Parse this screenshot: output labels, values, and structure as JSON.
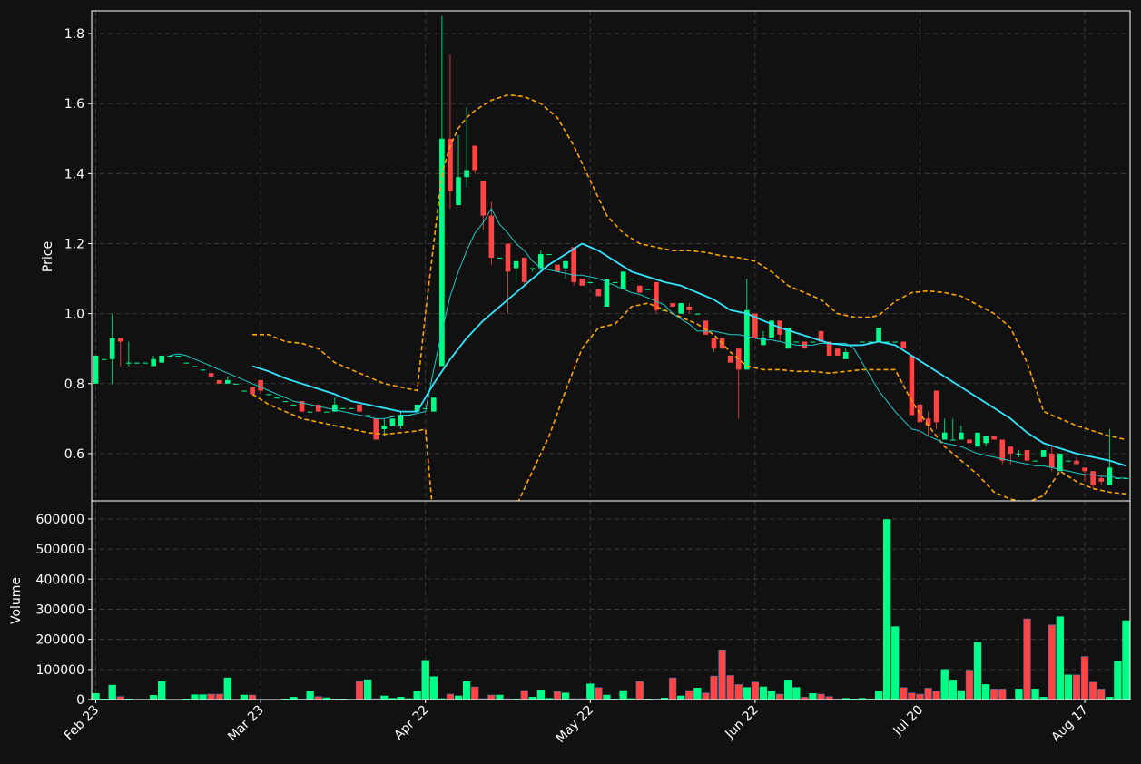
{
  "chart_data": {
    "type": "candlestick",
    "colors": {
      "background": "#111111",
      "up": "#00ff88",
      "down": "#ff4444",
      "grid": "#3a3a3a",
      "axis": "#ffffff",
      "sma_fast": "#1ec8c8",
      "sma_slow": "#33e6ff",
      "bollinger": "#ffa500"
    },
    "price_panel": {
      "ylabel": "Price",
      "ylim": [
        0.465,
        1.865
      ],
      "yticks": [
        0.6,
        0.8,
        1.0,
        1.2,
        1.4,
        1.6,
        1.8
      ],
      "ytick_labels": [
        "0.6",
        "0.8",
        "1.0",
        "1.2",
        "1.4",
        "1.6",
        "1.8"
      ]
    },
    "volume_panel": {
      "ylabel": "Volume",
      "ylim": [
        0,
        660000
      ],
      "yticks": [
        0,
        100000,
        200000,
        300000,
        400000,
        500000,
        600000
      ],
      "ytick_labels": [
        "0",
        "100000",
        "200000",
        "300000",
        "400000",
        "500000",
        "600000"
      ]
    },
    "xlim": [
      -0.5,
      125.5
    ],
    "xticks": [
      0,
      20,
      40,
      60,
      80,
      100,
      120
    ],
    "xtick_labels": [
      "Feb 23",
      "Mar 23",
      "Apr 22",
      "May 22",
      "Jun 22",
      "Jul 20",
      "Aug 17"
    ],
    "candles": [
      [
        0.8,
        0.88,
        0.8,
        0.88
      ],
      [
        0.87,
        0.87,
        0.87,
        0.87
      ],
      [
        0.87,
        1.0,
        0.8,
        0.93
      ],
      [
        0.93,
        0.93,
        0.85,
        0.92
      ],
      [
        0.86,
        0.92,
        0.85,
        0.86
      ],
      [
        0.86,
        0.86,
        0.86,
        0.86
      ],
      [
        0.86,
        0.86,
        0.86,
        0.86
      ],
      [
        0.85,
        0.88,
        0.85,
        0.87
      ],
      [
        0.86,
        0.88,
        0.86,
        0.88
      ],
      [
        0.88,
        0.88,
        0.88,
        0.88
      ],
      [
        0.88,
        0.88,
        0.88,
        0.88
      ],
      [
        0.86,
        0.86,
        0.86,
        0.86
      ],
      [
        0.85,
        0.85,
        0.85,
        0.85
      ],
      [
        0.84,
        0.84,
        0.84,
        0.84
      ],
      [
        0.83,
        0.83,
        0.82,
        0.82
      ],
      [
        0.81,
        0.81,
        0.8,
        0.8
      ],
      [
        0.8,
        0.82,
        0.8,
        0.81
      ],
      [
        0.8,
        0.8,
        0.8,
        0.8
      ],
      [
        0.78,
        0.78,
        0.78,
        0.78
      ],
      [
        0.79,
        0.79,
        0.77,
        0.77
      ],
      [
        0.81,
        0.81,
        0.77,
        0.78
      ],
      [
        0.77,
        0.77,
        0.77,
        0.77
      ],
      [
        0.76,
        0.76,
        0.76,
        0.76
      ],
      [
        0.75,
        0.75,
        0.75,
        0.75
      ],
      [
        0.74,
        0.74,
        0.74,
        0.74
      ],
      [
        0.75,
        0.75,
        0.72,
        0.72
      ],
      [
        0.72,
        0.72,
        0.72,
        0.72
      ],
      [
        0.74,
        0.74,
        0.72,
        0.72
      ],
      [
        0.72,
        0.72,
        0.72,
        0.72
      ],
      [
        0.72,
        0.76,
        0.72,
        0.74
      ],
      [
        0.73,
        0.73,
        0.73,
        0.73
      ],
      [
        0.73,
        0.73,
        0.73,
        0.73
      ],
      [
        0.74,
        0.74,
        0.72,
        0.72
      ],
      [
        0.71,
        0.71,
        0.71,
        0.71
      ],
      [
        0.7,
        0.7,
        0.64,
        0.64
      ],
      [
        0.67,
        0.7,
        0.65,
        0.68
      ],
      [
        0.68,
        0.7,
        0.68,
        0.7
      ],
      [
        0.68,
        0.72,
        0.67,
        0.71
      ],
      [
        0.71,
        0.71,
        0.71,
        0.71
      ],
      [
        0.72,
        0.74,
        0.72,
        0.74
      ],
      [
        0.73,
        0.73,
        0.73,
        0.73
      ],
      [
        0.72,
        0.76,
        0.72,
        0.76
      ],
      [
        0.85,
        1.85,
        0.85,
        1.5
      ],
      [
        1.5,
        1.74,
        1.3,
        1.35
      ],
      [
        1.31,
        1.51,
        1.31,
        1.39
      ],
      [
        1.39,
        1.59,
        1.36,
        1.41
      ],
      [
        1.48,
        1.48,
        1.4,
        1.41
      ],
      [
        1.38,
        1.38,
        1.24,
        1.28
      ],
      [
        1.28,
        1.32,
        1.14,
        1.16
      ],
      [
        1.16,
        1.16,
        1.16,
        1.16
      ],
      [
        1.2,
        1.2,
        1.0,
        1.12
      ],
      [
        1.13,
        1.16,
        1.09,
        1.15
      ],
      [
        1.16,
        1.16,
        1.08,
        1.09
      ],
      [
        1.13,
        1.13,
        1.12,
        1.13
      ],
      [
        1.13,
        1.18,
        1.12,
        1.17
      ],
      [
        1.17,
        1.17,
        1.17,
        1.17
      ],
      [
        1.14,
        1.14,
        1.12,
        1.12
      ],
      [
        1.13,
        1.15,
        1.1,
        1.15
      ],
      [
        1.19,
        1.19,
        1.08,
        1.09
      ],
      [
        1.1,
        1.1,
        1.08,
        1.08
      ],
      [
        1.09,
        1.09,
        1.09,
        1.09
      ],
      [
        1.07,
        1.07,
        1.05,
        1.05
      ],
      [
        1.02,
        1.1,
        1.02,
        1.1
      ],
      [
        1.09,
        1.09,
        1.09,
        1.09
      ],
      [
        1.07,
        1.12,
        1.07,
        1.12
      ],
      [
        1.1,
        1.1,
        1.1,
        1.1
      ],
      [
        1.08,
        1.08,
        1.06,
        1.06
      ],
      [
        1.07,
        1.07,
        1.07,
        1.07
      ],
      [
        1.09,
        1.09,
        1.0,
        1.01
      ],
      [
        1.01,
        1.01,
        1.01,
        1.01
      ],
      [
        1.03,
        1.03,
        1.02,
        1.02
      ],
      [
        1.0,
        1.03,
        1.0,
        1.03
      ],
      [
        1.02,
        1.03,
        1.0,
        1.01
      ],
      [
        1.0,
        1.0,
        1.0,
        1.0
      ],
      [
        0.98,
        0.98,
        0.94,
        0.94
      ],
      [
        0.93,
        0.93,
        0.89,
        0.9
      ],
      [
        0.93,
        0.93,
        0.9,
        0.9
      ],
      [
        0.88,
        0.88,
        0.86,
        0.86
      ],
      [
        0.9,
        0.9,
        0.7,
        0.84
      ],
      [
        0.84,
        1.1,
        0.84,
        1.01
      ],
      [
        1.0,
        1.0,
        0.93,
        0.93
      ],
      [
        0.91,
        0.95,
        0.91,
        0.93
      ],
      [
        0.93,
        0.98,
        0.93,
        0.98
      ],
      [
        0.98,
        0.98,
        0.92,
        0.94
      ],
      [
        0.9,
        0.96,
        0.9,
        0.96
      ],
      [
        0.92,
        0.92,
        0.92,
        0.92
      ],
      [
        0.92,
        0.92,
        0.9,
        0.9
      ],
      [
        0.92,
        0.92,
        0.92,
        0.92
      ],
      [
        0.95,
        0.95,
        0.92,
        0.92
      ],
      [
        0.92,
        0.92,
        0.88,
        0.88
      ],
      [
        0.9,
        0.9,
        0.88,
        0.88
      ],
      [
        0.87,
        0.9,
        0.87,
        0.89
      ],
      [
        0.91,
        0.91,
        0.91,
        0.91
      ],
      [
        0.92,
        0.92,
        0.92,
        0.92
      ],
      [
        0.92,
        0.92,
        0.92,
        0.92
      ],
      [
        0.92,
        0.96,
        0.92,
        0.96
      ],
      [
        0.92,
        0.92,
        0.92,
        0.92
      ],
      [
        0.92,
        0.92,
        0.92,
        0.92
      ],
      [
        0.92,
        0.92,
        0.9,
        0.9
      ],
      [
        0.88,
        0.88,
        0.71,
        0.71
      ],
      [
        0.74,
        0.74,
        0.65,
        0.69
      ],
      [
        0.7,
        0.72,
        0.65,
        0.68
      ],
      [
        0.78,
        0.78,
        0.67,
        0.69
      ],
      [
        0.64,
        0.7,
        0.64,
        0.66
      ],
      [
        0.64,
        0.7,
        0.64,
        0.64
      ],
      [
        0.64,
        0.68,
        0.64,
        0.66
      ],
      [
        0.64,
        0.64,
        0.63,
        0.63
      ],
      [
        0.62,
        0.66,
        0.62,
        0.66
      ],
      [
        0.63,
        0.65,
        0.62,
        0.65
      ],
      [
        0.65,
        0.65,
        0.64,
        0.64
      ],
      [
        0.64,
        0.64,
        0.57,
        0.58
      ],
      [
        0.62,
        0.62,
        0.57,
        0.6
      ],
      [
        0.6,
        0.61,
        0.59,
        0.6
      ],
      [
        0.61,
        0.61,
        0.58,
        0.58
      ],
      [
        0.58,
        0.58,
        0.58,
        0.58
      ],
      [
        0.59,
        0.61,
        0.59,
        0.61
      ],
      [
        0.6,
        0.62,
        0.55,
        0.56
      ],
      [
        0.55,
        0.6,
        0.55,
        0.6
      ],
      [
        0.58,
        0.58,
        0.58,
        0.58
      ],
      [
        0.58,
        0.59,
        0.57,
        0.57
      ],
      [
        0.56,
        0.56,
        0.52,
        0.55
      ],
      [
        0.55,
        0.55,
        0.5,
        0.51
      ],
      [
        0.53,
        0.54,
        0.51,
        0.52
      ],
      [
        0.51,
        0.67,
        0.51,
        0.56
      ],
      [
        0.53,
        0.53,
        0.53,
        0.53
      ],
      [
        0.53,
        0.53,
        0.53,
        0.53
      ],
      [
        0.53,
        0.53,
        0.53,
        0.53
      ],
      [
        0.55,
        0.56,
        0.49,
        0.5
      ],
      [
        0.49,
        0.67,
        0.49,
        0.5
      ]
    ],
    "volume": [
      20000,
      2000,
      48000,
      10000,
      2000,
      1000,
      1000,
      14000,
      60000,
      0,
      0,
      2000,
      16000,
      16000,
      18000,
      18000,
      72000,
      0,
      15000,
      15000,
      0,
      0,
      0,
      2000,
      8000,
      2000,
      28000,
      10000,
      6000,
      2000,
      2000,
      1000,
      60000,
      66000,
      3000,
      12000,
      4000,
      8000,
      3000,
      28000,
      130000,
      76000,
      3000,
      18000,
      12000,
      60000,
      42000,
      3000,
      15000,
      15000,
      3000,
      2000,
      30000,
      8000,
      32000,
      4000,
      26000,
      22000,
      3000,
      3000,
      52000,
      40000,
      15000,
      2000,
      30000,
      3000,
      60000,
      2000,
      2000,
      5000,
      72000,
      12000,
      30000,
      38000,
      22000,
      78000,
      165000,
      80000,
      50000,
      40000,
      58000,
      42000,
      28000,
      18000,
      65000,
      40000,
      8000,
      20000,
      18000,
      10000,
      2000,
      4000,
      2000,
      4000,
      2000,
      28000,
      598000,
      242000,
      40000,
      22000,
      18000,
      38000,
      28000,
      100000,
      65000,
      30000,
      98000,
      190000,
      50000,
      35000,
      35000,
      2000,
      35000,
      268000,
      35000,
      8000,
      248000,
      275000,
      82000,
      82000,
      143000,
      58000,
      35000,
      8000,
      128000,
      262000
    ],
    "sma_fast": {
      "x": [
        9,
        10,
        11,
        12,
        13,
        14,
        15,
        16,
        17,
        18,
        19,
        20,
        21,
        22,
        23,
        24,
        25,
        26,
        27,
        28,
        29,
        30,
        31,
        32,
        33,
        34,
        35,
        36,
        37,
        38,
        39,
        40,
        41,
        42,
        43,
        44,
        45,
        46,
        47,
        48,
        49,
        50,
        51,
        52,
        53,
        54,
        55,
        56,
        57,
        58,
        59,
        60,
        61,
        62,
        63,
        64,
        65,
        66,
        67,
        68,
        69,
        70,
        71,
        72,
        73,
        74,
        75,
        76,
        77,
        78,
        79,
        80,
        81,
        82,
        83,
        84,
        85,
        86,
        87,
        88,
        89,
        90,
        91,
        92,
        93,
        94,
        95,
        96,
        97,
        98,
        99,
        100,
        101,
        102,
        103,
        104,
        105,
        106,
        107,
        108,
        109,
        110,
        111,
        112,
        113,
        114,
        115,
        116,
        117,
        118,
        119,
        120,
        121,
        122,
        123,
        124,
        125
      ],
      "y": [
        0.88,
        0.885,
        0.88,
        0.87,
        0.86,
        0.85,
        0.84,
        0.83,
        0.82,
        0.81,
        0.8,
        0.79,
        0.78,
        0.77,
        0.76,
        0.75,
        0.745,
        0.74,
        0.735,
        0.73,
        0.725,
        0.72,
        0.715,
        0.71,
        0.705,
        0.7,
        0.7,
        0.705,
        0.71,
        0.71,
        0.715,
        0.72,
        0.84,
        0.95,
        1.05,
        1.12,
        1.18,
        1.23,
        1.26,
        1.3,
        1.255,
        1.23,
        1.2,
        1.18,
        1.15,
        1.13,
        1.125,
        1.12,
        1.115,
        1.11,
        1.11,
        1.105,
        1.1,
        1.09,
        1.08,
        1.07,
        1.06,
        1.055,
        1.045,
        1.035,
        1.025,
        1.0,
        0.985,
        0.97,
        0.95,
        0.95,
        0.95,
        0.945,
        0.94,
        0.94,
        0.935,
        0.93,
        0.925,
        0.925,
        0.92,
        0.915,
        0.91,
        0.91,
        0.91,
        0.915,
        0.915,
        0.915,
        0.915,
        0.9,
        0.86,
        0.82,
        0.78,
        0.75,
        0.72,
        0.695,
        0.67,
        0.665,
        0.65,
        0.64,
        0.63,
        0.625,
        0.62,
        0.61,
        0.6,
        0.595,
        0.59,
        0.585,
        0.58,
        0.575,
        0.57,
        0.565,
        0.565,
        0.56,
        0.555,
        0.55,
        0.545,
        0.54,
        0.54,
        0.535,
        0.535,
        0.53,
        0.53
      ]
    },
    "sma_slow": {
      "x": [
        19,
        21,
        23,
        25,
        27,
        29,
        31,
        33,
        35,
        37,
        39,
        41,
        43,
        45,
        47,
        49,
        51,
        53,
        55,
        57,
        59,
        61,
        63,
        65,
        67,
        69,
        71,
        73,
        75,
        77,
        79,
        81,
        83,
        85,
        87,
        89,
        91,
        93,
        95,
        97,
        99,
        101,
        103,
        105,
        107,
        109,
        111,
        113,
        115,
        117,
        119,
        121,
        123,
        125
      ],
      "y": [
        0.85,
        0.835,
        0.815,
        0.8,
        0.785,
        0.77,
        0.75,
        0.74,
        0.73,
        0.72,
        0.72,
        0.8,
        0.87,
        0.93,
        0.98,
        1.02,
        1.06,
        1.1,
        1.14,
        1.17,
        1.2,
        1.18,
        1.15,
        1.12,
        1.105,
        1.09,
        1.08,
        1.06,
        1.04,
        1.01,
        1.0,
        0.98,
        0.96,
        0.945,
        0.93,
        0.915,
        0.91,
        0.91,
        0.92,
        0.91,
        0.88,
        0.85,
        0.82,
        0.79,
        0.76,
        0.73,
        0.7,
        0.66,
        0.63,
        0.615,
        0.6,
        0.59,
        0.58,
        0.565
      ]
    },
    "bollinger_upper": {
      "x": [
        19,
        21,
        23,
        25,
        27,
        29,
        31,
        33,
        35,
        37,
        39,
        40,
        41,
        42,
        43,
        44,
        45,
        46,
        47,
        48,
        50,
        52,
        54,
        56,
        58,
        60,
        62,
        64,
        66,
        68,
        70,
        72,
        74,
        76,
        78,
        80,
        82,
        84,
        86,
        88,
        90,
        92,
        94,
        95,
        97,
        99,
        101,
        103,
        105,
        107,
        109,
        111,
        113,
        115,
        117,
        119,
        121,
        123,
        125
      ],
      "y": [
        0.94,
        0.94,
        0.92,
        0.915,
        0.9,
        0.86,
        0.84,
        0.82,
        0.8,
        0.79,
        0.78,
        1.0,
        1.2,
        1.4,
        1.48,
        1.53,
        1.56,
        1.58,
        1.595,
        1.61,
        1.625,
        1.62,
        1.6,
        1.56,
        1.48,
        1.38,
        1.28,
        1.23,
        1.2,
        1.19,
        1.18,
        1.18,
        1.175,
        1.165,
        1.16,
        1.15,
        1.12,
        1.08,
        1.06,
        1.04,
        1.0,
        0.99,
        0.99,
        0.995,
        1.035,
        1.06,
        1.065,
        1.06,
        1.05,
        1.025,
        1.0,
        0.96,
        0.86,
        0.72,
        0.7,
        0.68,
        0.665,
        0.65,
        0.64
      ]
    },
    "bollinger_lower": {
      "x": [
        19,
        21,
        23,
        25,
        27,
        29,
        31,
        33,
        35,
        37,
        39,
        40,
        41,
        43,
        45,
        47,
        49,
        51,
        53,
        55,
        57,
        59,
        61,
        63,
        65,
        67,
        69,
        71,
        73,
        75,
        77,
        79,
        81,
        83,
        85,
        87,
        89,
        91,
        93,
        95,
        97,
        99,
        101,
        103,
        105,
        107,
        109,
        111,
        113,
        115,
        117,
        119,
        121,
        123,
        125
      ],
      "y": [
        0.77,
        0.74,
        0.72,
        0.7,
        0.69,
        0.68,
        0.67,
        0.66,
        0.655,
        0.66,
        0.665,
        0.67,
        0.4,
        0.27,
        0.26,
        0.3,
        0.36,
        0.45,
        0.55,
        0.65,
        0.78,
        0.9,
        0.96,
        0.97,
        1.02,
        1.03,
        1.01,
        0.99,
        0.97,
        0.94,
        0.89,
        0.85,
        0.84,
        0.84,
        0.835,
        0.835,
        0.83,
        0.835,
        0.84,
        0.84,
        0.84,
        0.75,
        0.68,
        0.62,
        0.58,
        0.54,
        0.49,
        0.47,
        0.46,
        0.48,
        0.55,
        0.52,
        0.5,
        0.49,
        0.485
      ]
    }
  }
}
